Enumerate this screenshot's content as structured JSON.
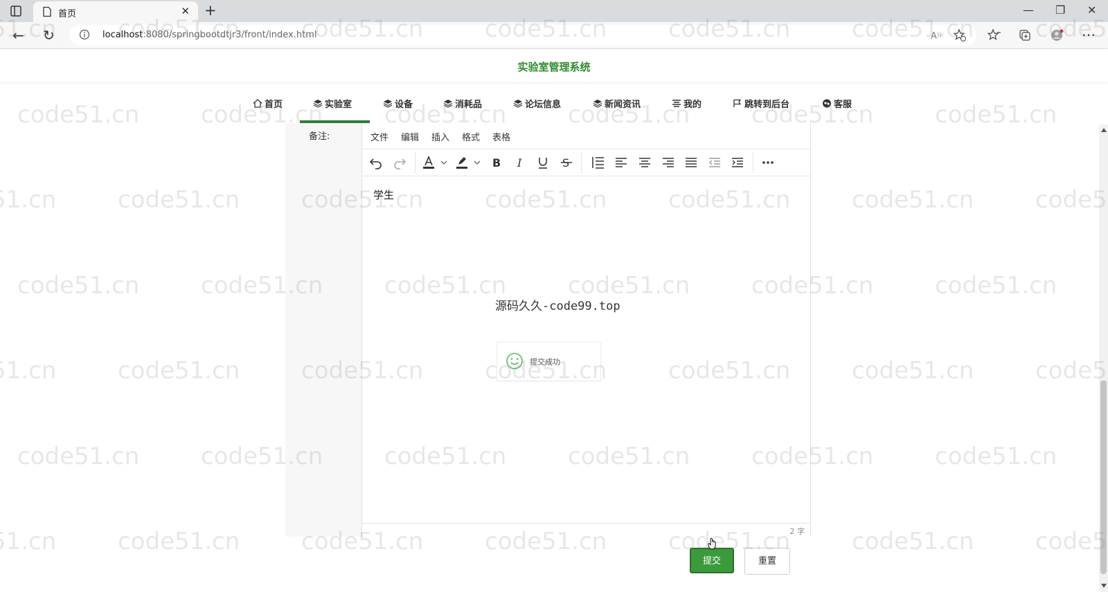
{
  "browser": {
    "tab_title": "首页",
    "url_host": "localhost",
    "url_rest": ":8080/springbootdtjr3/front/index.html"
  },
  "site": {
    "title": "实验室管理系统"
  },
  "nav": {
    "items": [
      {
        "label": "首页",
        "icon": "home-icon"
      },
      {
        "label": "实验室",
        "icon": "layers-icon"
      },
      {
        "label": "设备",
        "icon": "layers-icon"
      },
      {
        "label": "消耗品",
        "icon": "layers-icon"
      },
      {
        "label": "论坛信息",
        "icon": "layers-icon"
      },
      {
        "label": "新闻资讯",
        "icon": "layers-icon"
      },
      {
        "label": "我的",
        "icon": "list-icon"
      },
      {
        "label": "跳转到后台",
        "icon": "flag-icon"
      },
      {
        "label": "客服",
        "icon": "chat-icon"
      }
    ],
    "active_index": 1,
    "active_color": "#2e7d32"
  },
  "form": {
    "remark_label": "备注:",
    "editor": {
      "menus": [
        "文件",
        "编辑",
        "插入",
        "格式",
        "表格"
      ],
      "content": "学生",
      "word_count": "2 字"
    },
    "submit_label": "提交",
    "reset_label": "重置"
  },
  "overlay": {
    "site_text": "源码久久-code99.top",
    "toast_message": "提交成功"
  },
  "watermark": {
    "text": "code51.cn"
  },
  "colors": {
    "brand_green": "#2e8b2e",
    "submit_bg": "#3b9a3b"
  }
}
